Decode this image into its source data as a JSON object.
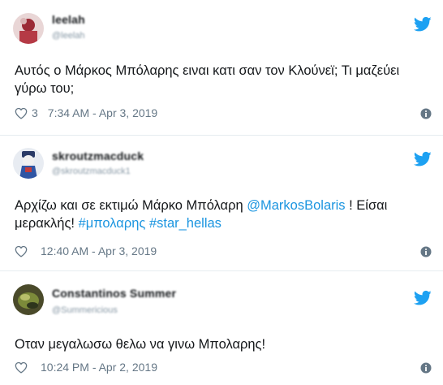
{
  "colors": {
    "link": "#1b95e0",
    "text": "#14171a",
    "meta": "#657786",
    "divider": "#e6ecf0",
    "bird": "#1da1f2"
  },
  "icons": {
    "bird": "twitter-bird-icon",
    "heart": "heart-icon",
    "info": "info-icon"
  },
  "tweets": [
    {
      "name": "leelah",
      "handle": "@leelah",
      "text": "Αυτός ο Μάρκος Μπόλαρης ειναι κατι σαν τον Κλούνεϊ; Τι μαζεύει γύρω του;",
      "likes": "3",
      "time": "7:34 AM - Apr 3, 2019"
    },
    {
      "name": "skroutzmacduck",
      "handle": "@skroutzmacduck1",
      "text_pre": "Αρχίζω και σε εκτιμώ Μάρκο Μπόλαρη ",
      "mention": "@MarkosBolaris",
      "text_mid": " ! Είσαι μερακλής! ",
      "hashtag1": "#μπολαρης",
      "hashtag2": "#star_hellas",
      "time": "12:40 AM - Apr 3, 2019"
    },
    {
      "name": "Constantinos Summer",
      "handle": "@Summericious",
      "text": "Οταν μεγαλωσω θελω να γινω Μπολαρης!",
      "time": "10:24 PM - Apr 2, 2019"
    }
  ]
}
